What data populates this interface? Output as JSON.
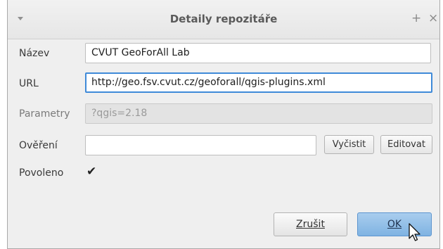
{
  "dialog": {
    "title": "Detaily repozitáře",
    "titlebar_icons": [
      "menu-arrow-icon",
      "plus-icon",
      "close-icon"
    ],
    "plus_glyph": "+",
    "close_glyph": "×"
  },
  "form": {
    "name": {
      "label": "Název",
      "value": "CVUT GeoForAll Lab"
    },
    "url": {
      "label": "URL",
      "value": "http://geo.fsv.cvut.cz/geoforall/qgis-plugins.xml"
    },
    "parameters": {
      "label": "Parametry",
      "value": "?qgis=2.18"
    },
    "auth": {
      "label": "Ověření",
      "value": "",
      "clear_label": "Vyčistit",
      "edit_label": "Editovat"
    },
    "enabled": {
      "label": "Povoleno",
      "checked": true,
      "check_glyph": "✔"
    }
  },
  "buttons": {
    "cancel_label": "Zrušit",
    "ok_label": "OK"
  },
  "colors": {
    "focus_border": "#3f8ad8",
    "ok_button": "#8fbde8",
    "dialog_bg": "#efefef"
  }
}
